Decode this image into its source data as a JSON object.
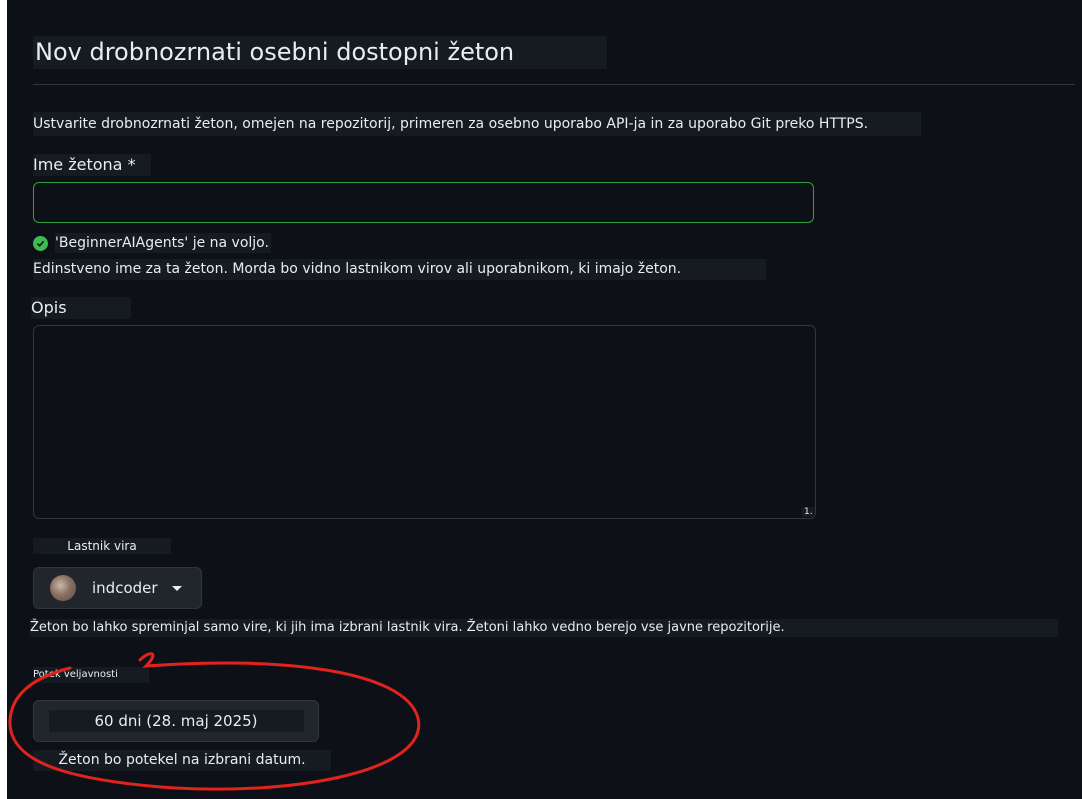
{
  "page": {
    "title": "Nov drobnozrnati osebni dostopni žeton",
    "intro": "Ustvarite drobnozrnati žeton, omejen na repozitorij, primeren za osebno uporabo API-ja in za uporabo Git preko HTTPS."
  },
  "token_name": {
    "label": "Ime žetona *",
    "value": "",
    "validation": "'BeginnerAIAgents' je na voljo.",
    "hint": "Edinstveno ime za ta žeton. Morda bo vidno lastnikom virov ali uporabnikom, ki imajo žeton."
  },
  "description": {
    "label": "Opis",
    "value": "",
    "resize_marker": "1."
  },
  "resource_owner": {
    "label": "Lastnik vira",
    "selected": "indcoder",
    "hint": "Žeton bo lahko spreminjal samo vire, ki jih ima izbrani lastnik vira. Žetoni lahko vedno berejo vse javne repozitorije."
  },
  "expiration": {
    "label": "Potek veljavnosti",
    "selected": "60 dni (28. maj 2025)",
    "hint": "Žeton bo potekel na izbrani datum."
  },
  "colors": {
    "background": "#0d1117",
    "input_valid_border": "#2ea043",
    "success_icon": "#3fb950",
    "annotation": "#e0231c"
  },
  "icons": {
    "validation": "check-circle-icon",
    "owner_dropdown": "caret-down-icon"
  }
}
